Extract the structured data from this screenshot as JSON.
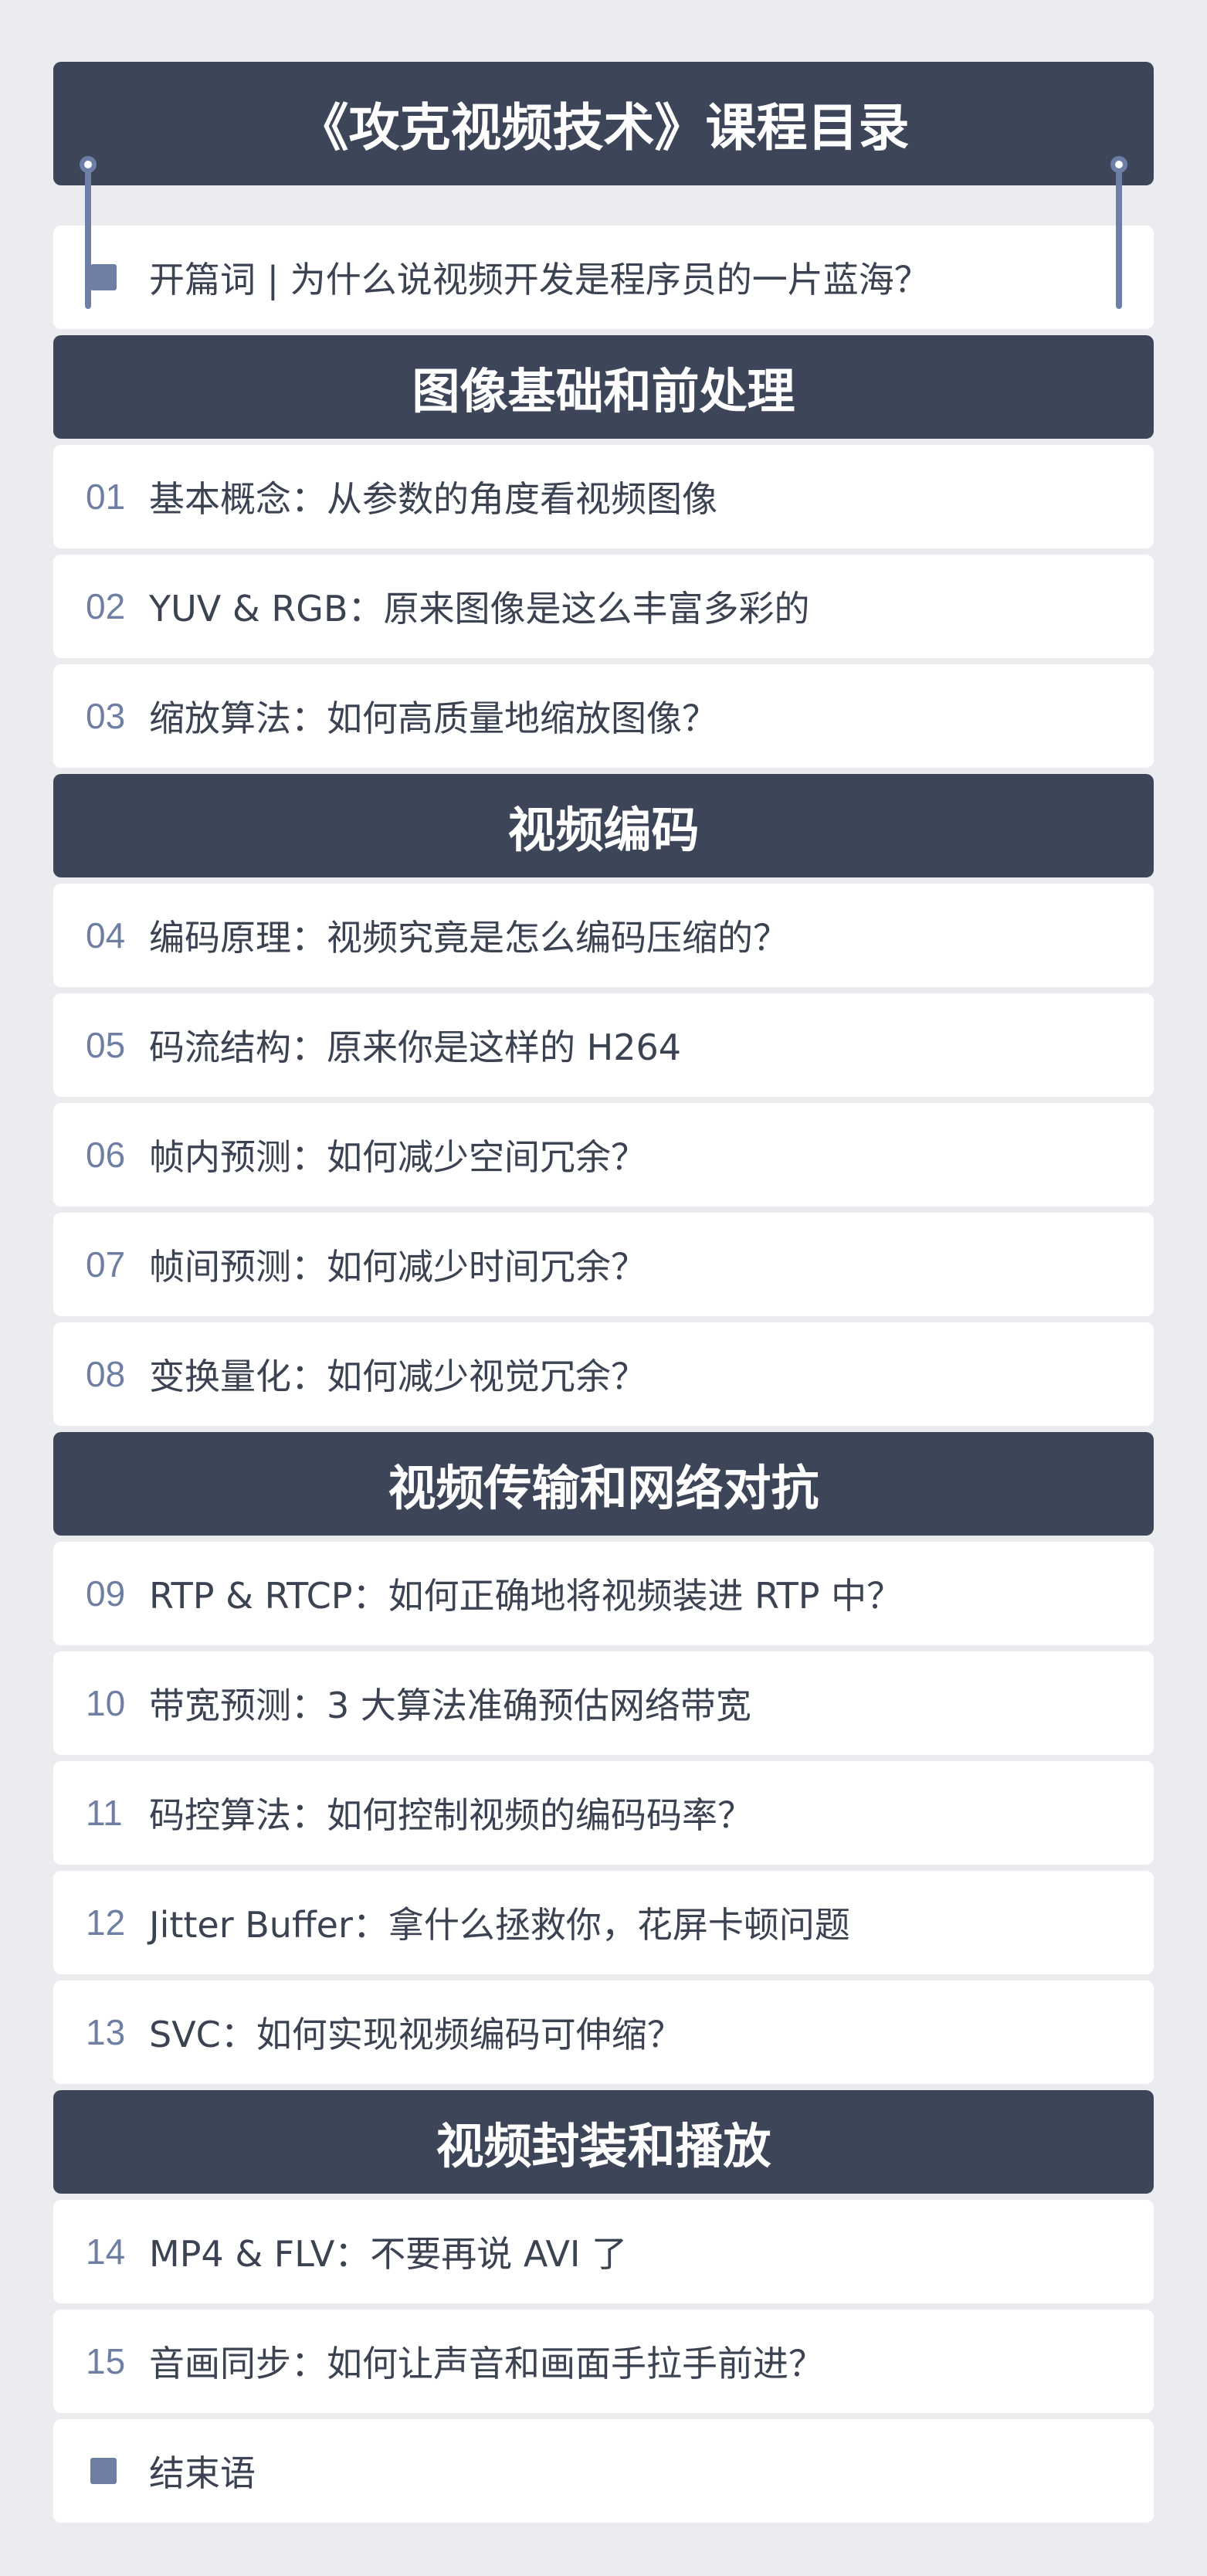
{
  "title": "《攻克视频技术》课程目录",
  "intro": "开篇词 | 为什么说视频开发是程序员的一片蓝海？",
  "sections": [
    {
      "heading": "图像基础和前处理",
      "items": [
        {
          "num": "01",
          "title": "基本概念：从参数的角度看视频图像"
        },
        {
          "num": "02",
          "title": "YUV & RGB：原来图像是这么丰富多彩的"
        },
        {
          "num": "03",
          "title": "缩放算法：如何高质量地缩放图像？"
        }
      ]
    },
    {
      "heading": "视频编码",
      "items": [
        {
          "num": "04",
          "title": "编码原理：视频究竟是怎么编码压缩的？"
        },
        {
          "num": "05",
          "title": "码流结构：原来你是这样的 H264"
        },
        {
          "num": "06",
          "title": "帧内预测：如何减少空间冗余？"
        },
        {
          "num": "07",
          "title": "帧间预测：如何减少时间冗余？"
        },
        {
          "num": "08",
          "title": "变换量化：如何减少视觉冗余？"
        }
      ]
    },
    {
      "heading": "视频传输和网络对抗",
      "items": [
        {
          "num": "09",
          "title": "RTP & RTCP：如何正确地将视频装进 RTP 中？"
        },
        {
          "num": "10",
          "title": "带宽预测：3 大算法准确预估网络带宽"
        },
        {
          "num": "11",
          "title": "码控算法：如何控制视频的编码码率？"
        },
        {
          "num": "12",
          "title": "Jitter Buffer：拿什么拯救你，花屏卡顿问题"
        },
        {
          "num": "13",
          "title": "SVC：如何实现视频编码可伸缩？"
        }
      ]
    },
    {
      "heading": "视频封装和播放",
      "items": [
        {
          "num": "14",
          "title": "MP4 & FLV：不要再说 AVI 了"
        },
        {
          "num": "15",
          "title": "音画同步：如何让声音和画面手拉手前进？"
        }
      ]
    }
  ],
  "outro": "结束语",
  "colors": {
    "background": "#eaecf0",
    "header": "#3d4659",
    "accent": "#6f7fa3",
    "text": "#3b4252"
  },
  "icons": {
    "bullet": "square-bullet-icon",
    "pin": "pin-icon"
  }
}
